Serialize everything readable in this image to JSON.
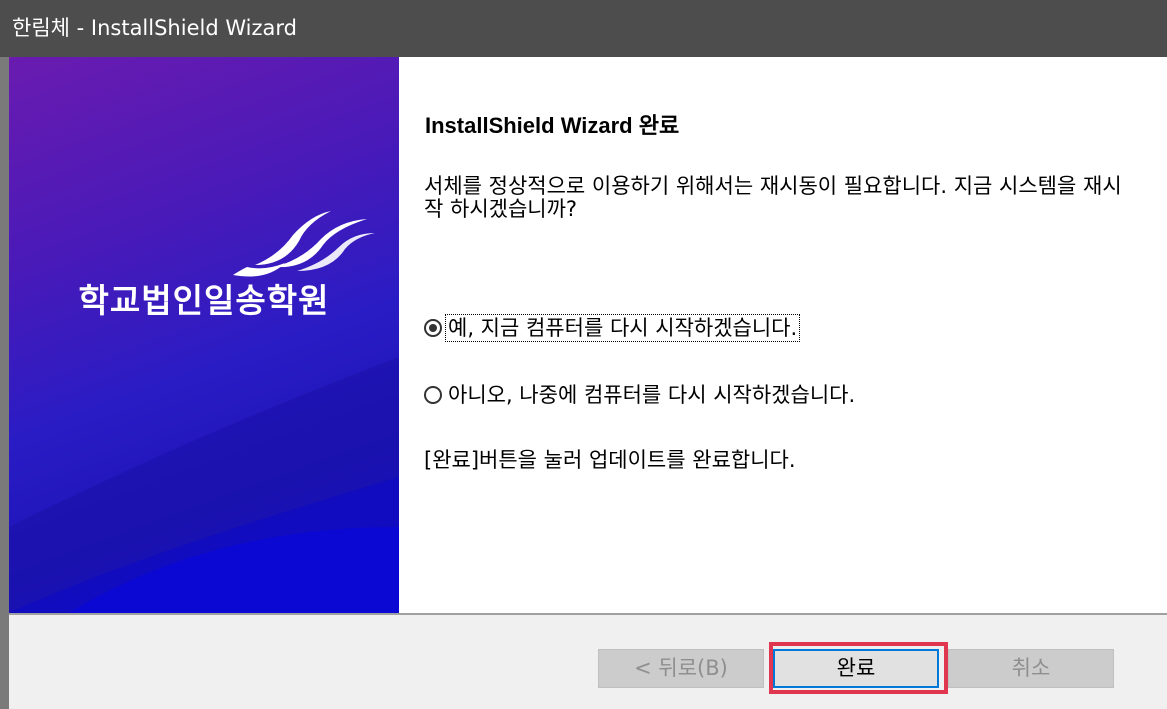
{
  "window": {
    "title": "한림체 - InstallShield Wizard"
  },
  "banner": {
    "school_name": "학교법인일송학원"
  },
  "main": {
    "heading": "InstallShield Wizard 완료",
    "description": "서체를 정상적으로 이용하기 위해서는 재시동이 필요합니다. 지금 시스템을 재시작 하시겠습니까?",
    "options": [
      {
        "label": "예, 지금 컴퓨터를 다시 시작하겠습니다.",
        "selected": true
      },
      {
        "label": "아니오, 나중에 컴퓨터를 다시 시작하겠습니다.",
        "selected": false
      }
    ],
    "finish_note": "[완료]버튼을 눌러 업데이트를 완료합니다."
  },
  "footer": {
    "back_label": "< 뒤로(B)",
    "finish_label": "완료",
    "cancel_label": "취소"
  },
  "colors": {
    "titlebar": "#4d4d4d",
    "banner_start": "#6a1bb0",
    "banner_end": "#0c0bd6",
    "footer": "#f0f0f0",
    "focus_border": "#0078d7",
    "highlight": "#e0364f"
  },
  "icons": {
    "logo": "wave-logo-icon",
    "radio_checked": "radio-checked-icon",
    "radio_unchecked": "radio-unchecked-icon"
  }
}
